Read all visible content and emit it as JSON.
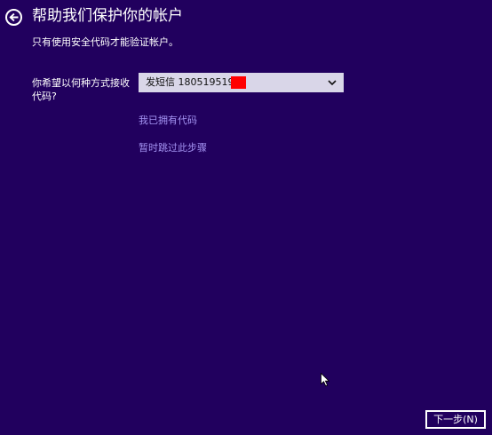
{
  "header": {
    "title": "帮助我们保护你的帐户",
    "back_icon": "back-arrow-icon"
  },
  "subtitle": "只有使用安全代码才能验证帐户。",
  "method": {
    "label": "你希望以何种方式接收代码?",
    "selected_value": "发短信 180519519",
    "dropdown_icon": "chevron-down-icon"
  },
  "links": {
    "have_code": "我已拥有代码",
    "skip": "暂时跳过此步骤"
  },
  "footer": {
    "next_label": "下一步(N)"
  },
  "colors": {
    "background": "#21005e",
    "text": "#ffffff",
    "link": "#a493f2",
    "select_background": "#d9d6e8",
    "redaction": "#ff0000"
  }
}
